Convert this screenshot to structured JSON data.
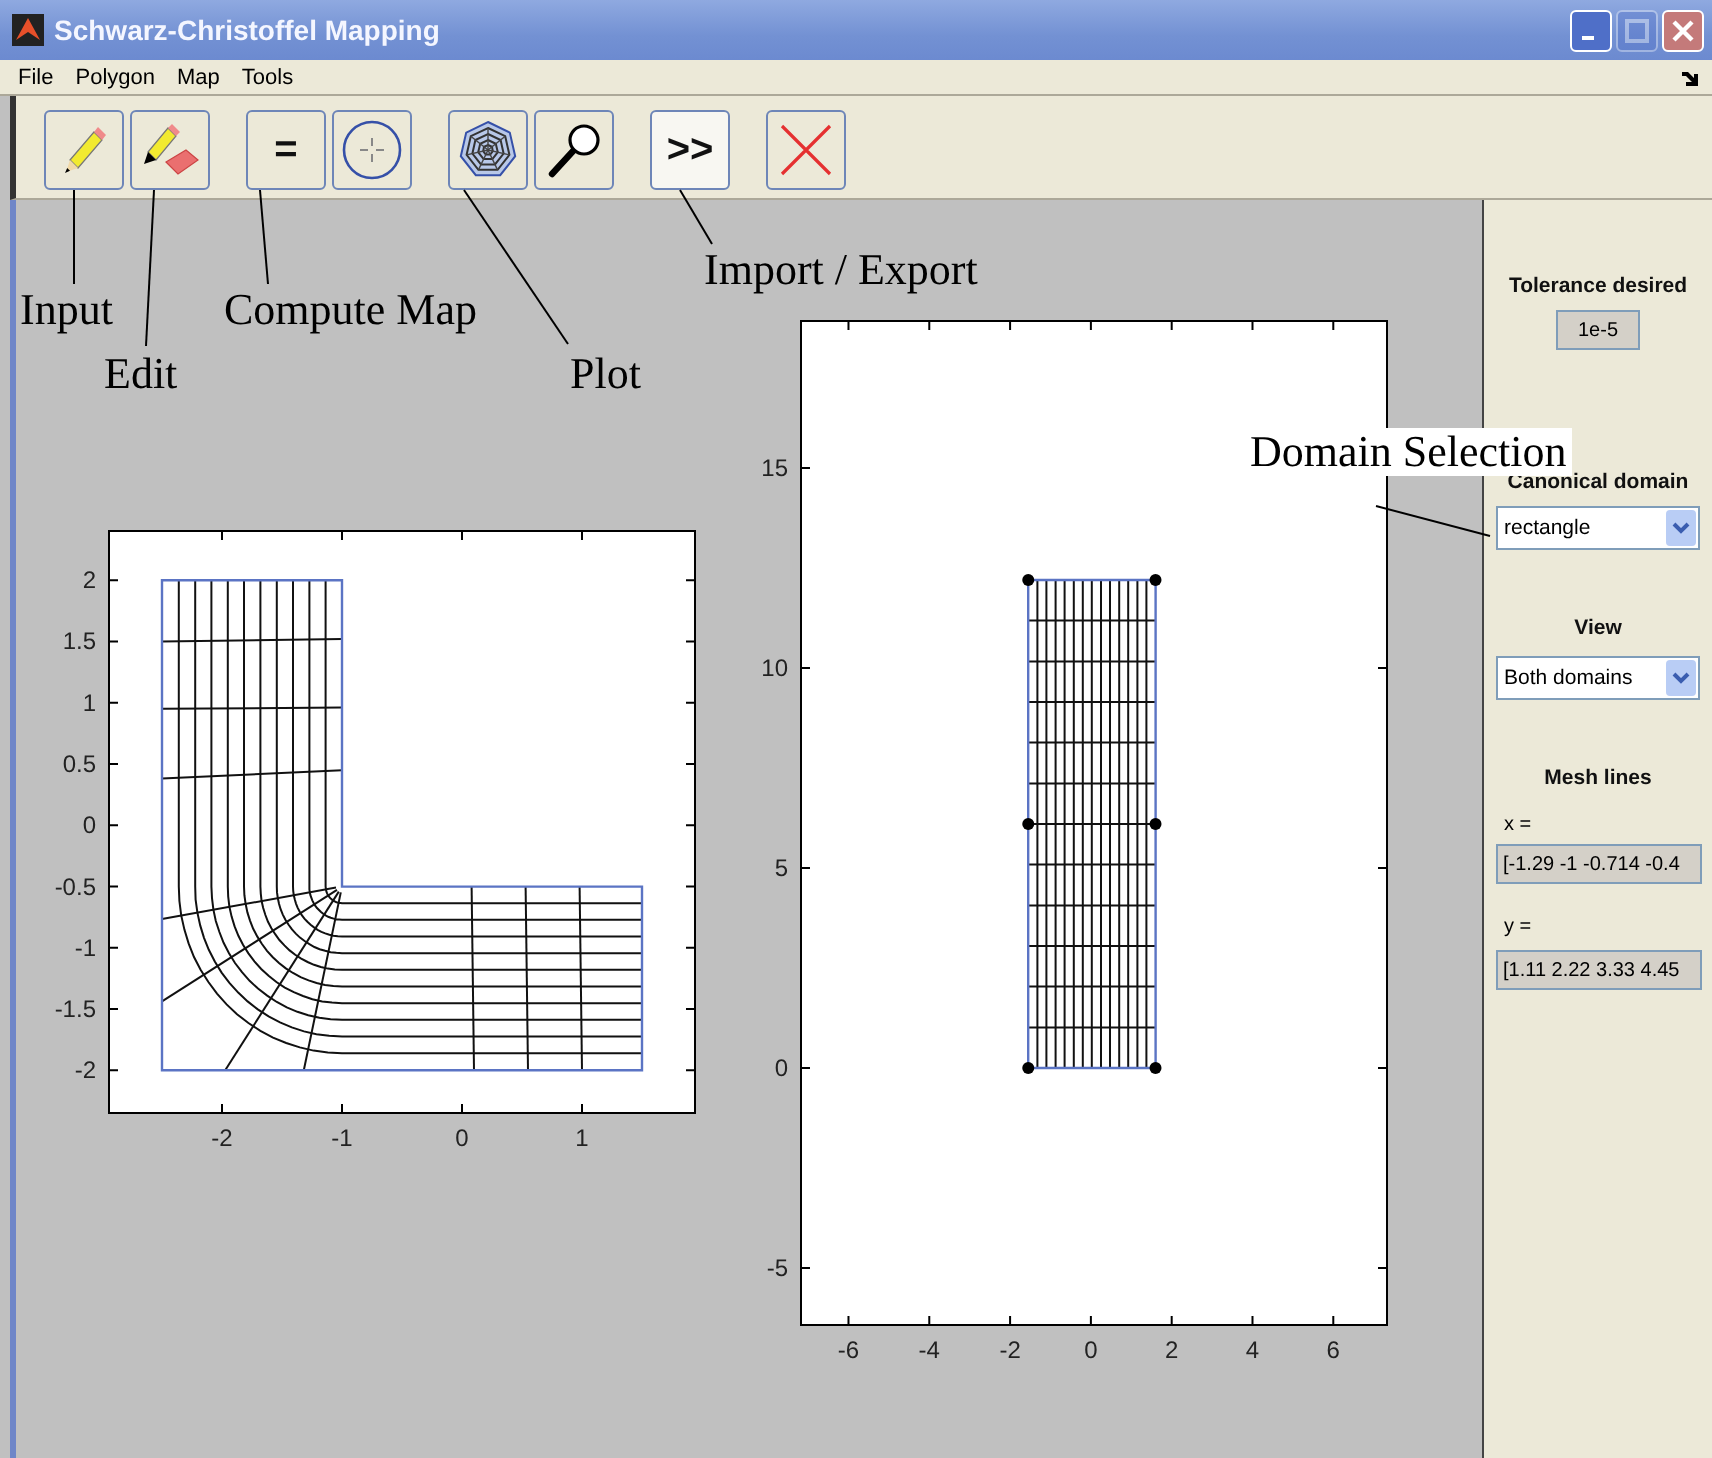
{
  "window": {
    "title": "Schwarz-Christoffel Mapping",
    "controls": [
      {
        "kind": "minimize",
        "disabled": false
      },
      {
        "kind": "maximize",
        "disabled": true
      },
      {
        "kind": "close",
        "disabled": false
      }
    ]
  },
  "menu": [
    "File",
    "Polygon",
    "Map",
    "Tools"
  ],
  "toolbar": [
    [
      {
        "kind": "pencil",
        "pressed": false
      },
      {
        "kind": "pencil-eraser",
        "pressed": false
      }
    ],
    [
      {
        "kind": "text",
        "label": "=",
        "pressed": false
      },
      {
        "kind": "crosshair",
        "pressed": false
      }
    ],
    [
      {
        "kind": "web",
        "pressed": false
      },
      {
        "kind": "magnifier",
        "pressed": false
      }
    ],
    [
      {
        "kind": "text",
        "label": ">>",
        "pressed": true
      }
    ],
    [
      {
        "kind": "cross",
        "pressed": false
      }
    ]
  ],
  "annotations": [
    "Input",
    "Edit",
    "Compute Map",
    "Plot",
    "Import / Export",
    "Domain Selection"
  ],
  "plots": [
    {
      "kind": "polygon",
      "xticks": [
        "-2",
        "-1",
        "0",
        "1"
      ],
      "yticks": [
        "2",
        "1.5",
        "1",
        "0.5",
        "0",
        "-0.5",
        "-1",
        "-1.5",
        "-2"
      ]
    },
    {
      "kind": "rectangle",
      "xticks": [
        "-6",
        "-4",
        "-2",
        "0",
        "2",
        "4",
        "6"
      ],
      "yticks": [
        "15",
        "10",
        "5",
        "0",
        "-5"
      ]
    }
  ],
  "panel": {
    "tolerance": {
      "label": "Tolerance desired",
      "value": "1e-5"
    },
    "canonical_domain": {
      "label": "Canonical domain",
      "value": "rectangle"
    },
    "view": {
      "label": "View",
      "value": "Both domains"
    },
    "mesh_lines": {
      "label": "Mesh lines",
      "x_label": "x =",
      "x_value": "[-1.29 -1 -0.714 -0.4",
      "y_label": "y =",
      "y_value": "[1.11 2.22 3.33 4.45"
    }
  }
}
